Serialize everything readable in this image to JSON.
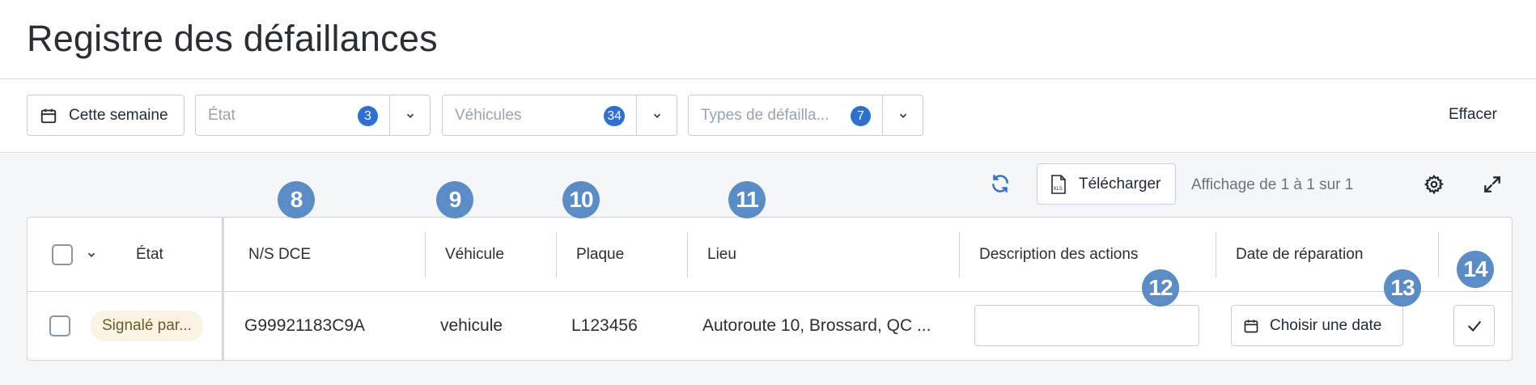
{
  "page": {
    "title": "Registre des défaillances"
  },
  "filters": {
    "period_label": "Cette semaine",
    "etat": {
      "placeholder": "État",
      "count": "3"
    },
    "vehicules": {
      "placeholder": "Véhicules",
      "count": "34"
    },
    "types": {
      "placeholder": "Types de défailla...",
      "count": "7"
    },
    "clear_label": "Effacer"
  },
  "toolbar": {
    "download_label": "Télécharger",
    "pagination_text": "Affichage de 1 à 1 sur 1"
  },
  "table": {
    "columns": {
      "etat": "État",
      "ns_dce": "N/S DCE",
      "vehicule": "Véhicule",
      "plaque": "Plaque",
      "lieu": "Lieu",
      "description": "Description des actions",
      "date_reparation": "Date de réparation"
    },
    "rows": [
      {
        "etat": "Signalé par...",
        "ns_dce": "G99921183C9A",
        "vehicule": "vehicule",
        "plaque": "L123456",
        "lieu": "Autoroute 10, Brossard, QC ...",
        "description": "",
        "date_button": "Choisir une date"
      }
    ]
  },
  "markers": [
    "8",
    "9",
    "10",
    "11",
    "12",
    "13",
    "14"
  ],
  "colors": {
    "accent": "#2f6fd0",
    "marker": "#5b8cc6",
    "status_bg": "#fbf3e3"
  }
}
